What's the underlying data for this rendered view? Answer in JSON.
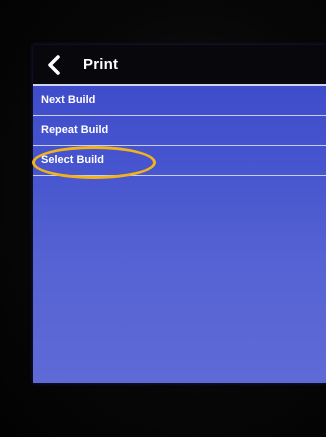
{
  "header": {
    "back_icon": "chevron-left-icon",
    "title": "Print"
  },
  "menu": {
    "items": [
      {
        "label": "Next Build"
      },
      {
        "label": "Repeat Build"
      },
      {
        "label": "Select Build"
      }
    ]
  },
  "annotation": {
    "highlighted_item": "Select Build",
    "color": "#f2b21b"
  },
  "theme": {
    "screen_bg": "#4655cf",
    "header_bg": "#07070c",
    "divider": "#c9cdf0",
    "text": "#ffffff"
  }
}
